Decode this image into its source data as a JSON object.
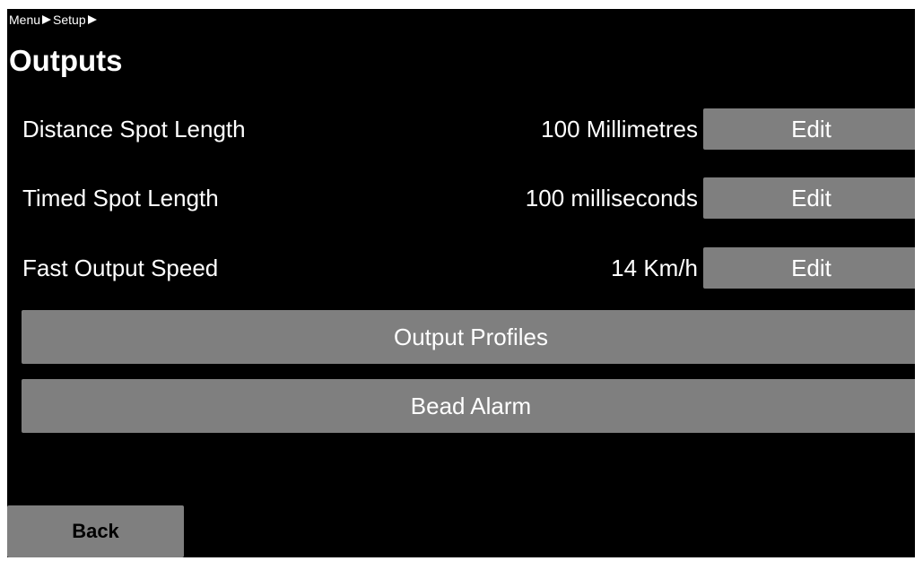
{
  "breadcrumb": {
    "items": [
      "Menu",
      "Setup"
    ],
    "separator_icon": "right-triangle-icon"
  },
  "page": {
    "title": "Outputs"
  },
  "settings": [
    {
      "label": "Distance Spot Length",
      "value": "100 Millimetres",
      "action": "Edit"
    },
    {
      "label": "Timed Spot Length",
      "value": "100 milliseconds",
      "action": "Edit"
    },
    {
      "label": "Fast Output Speed",
      "value": "14 Km/h",
      "action": "Edit"
    }
  ],
  "actions": {
    "output_profiles": "Output Profiles",
    "bead_alarm": "Bead Alarm"
  },
  "footer": {
    "back": "Back"
  },
  "colors": {
    "background": "#000000",
    "button": "#7f7f7f",
    "text": "#ffffff"
  }
}
